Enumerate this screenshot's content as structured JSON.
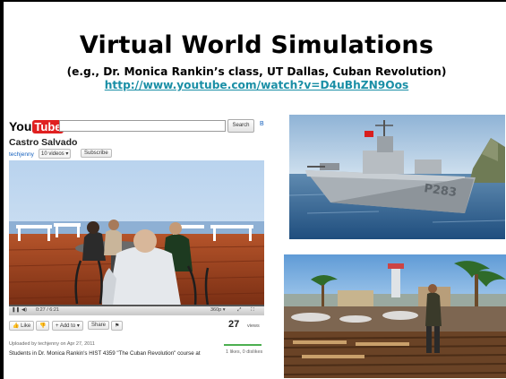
{
  "slide": {
    "title": "Virtual World Simulations",
    "subtitle": "(e.g., Dr. Monica Rankin’s class, UT Dallas, Cuban Revolution)",
    "link": "http://www.youtube.com/watch?v=D4uBhZN9Oos"
  },
  "youtube": {
    "logo_you": "You",
    "logo_tube": "Tube",
    "search_button": "Search",
    "header_link": "B",
    "video_title": "Castro Salvado",
    "username": "techjenny",
    "videos_dropdown": "10 videos ▾",
    "subscribe_label": "Subscribe",
    "time": "0:27 / 6:21",
    "quality": "360p ▾",
    "like_label": "Like",
    "add_to_label": "+ Add to ▾",
    "share_label": "Share",
    "views_count": "27",
    "views_label": "views",
    "upload_info": "Uploaded by techjenny on Apr 27, 2011",
    "description": "Students in Dr. Monica Rankin's HIST 4359 \"The Cuban Revolution\" course at",
    "likes_info": "1 likes, 0 dislikes"
  },
  "ship": {
    "hull_number": "P283"
  },
  "colors": {
    "link": "#1a8fa6",
    "youtube_red": "#e02020"
  }
}
